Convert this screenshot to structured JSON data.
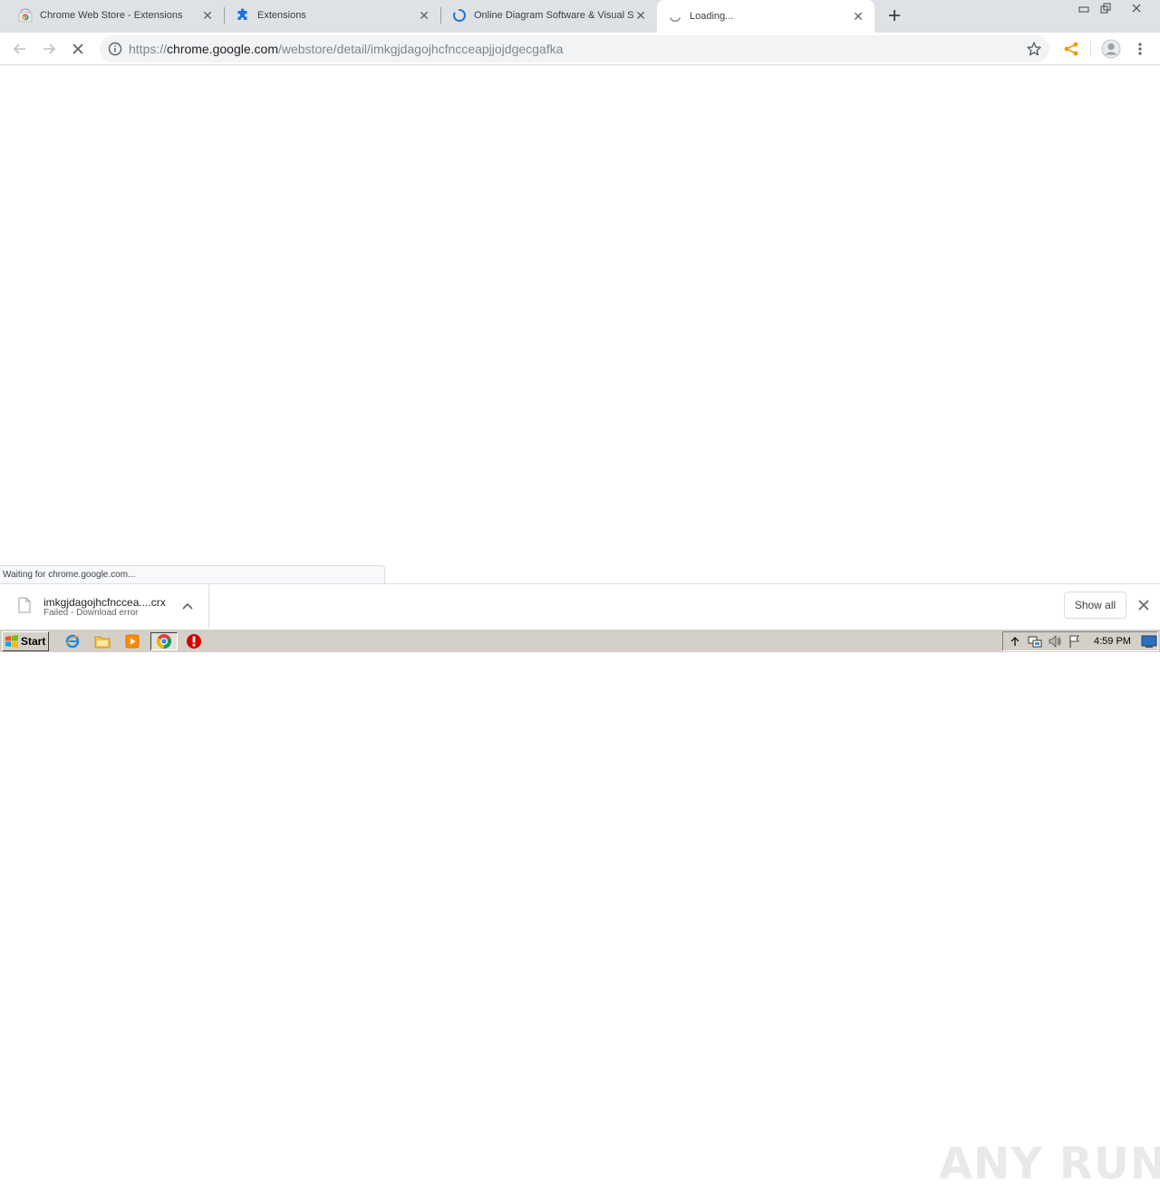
{
  "tabs": [
    {
      "title": "Chrome Web Store - Extensions",
      "icon": "chrome-web-store-icon"
    },
    {
      "title": "Extensions",
      "icon": "puzzle-piece-icon"
    },
    {
      "title": "Online Diagram Software & Visual Solution",
      "icon": "loading-spinner-icon"
    },
    {
      "title": "Loading...",
      "icon": "loading-spinner-icon",
      "active": true
    }
  ],
  "omnibox": {
    "scheme": "https://",
    "host": "chrome.google.com",
    "path": "/webstore/detail/imkgjdagojhcfncceapjjojdgecgafka"
  },
  "status_bubble": "Waiting for chrome.google.com...",
  "download": {
    "filename": "imkgjdagojhcfnccea....crx",
    "status": "Failed - Download error"
  },
  "shelf": {
    "show_all_label": "Show all"
  },
  "watermark": "ANY RUN",
  "taskbar": {
    "start_label": "Start",
    "clock": "4:59 PM"
  },
  "colors": {
    "tabstrip_bg": "#dee1e6",
    "omnibox_bg": "#f1f3f4",
    "taskbar_bg": "#d4d0c8",
    "accent_blue": "#1a73e8",
    "extension_orange": "#f29900"
  }
}
